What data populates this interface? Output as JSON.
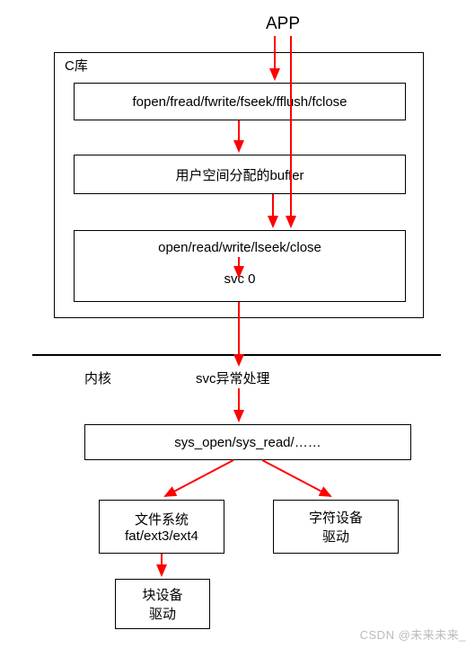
{
  "top_label": "APP",
  "c_lib_label": "C库",
  "c_lib_box1": "fopen/fread/fwrite/fseek/fflush/fclose",
  "c_lib_box2": "用户空间分配的buffer",
  "c_lib_box3_line1": "open/read/write/lseek/close",
  "c_lib_box3_line2": "svc 0",
  "kernel_label": "内核",
  "svc_handler": "svc异常处理",
  "sys_calls": "sys_open/sys_read/……",
  "fs_line1": "文件系统",
  "fs_line2": "fat/ext3/ext4",
  "block_line1": "块设备",
  "block_line2": "驱动",
  "char_line1": "字符设备",
  "char_line2": "驱动",
  "watermark": "CSDN @未来未来_"
}
